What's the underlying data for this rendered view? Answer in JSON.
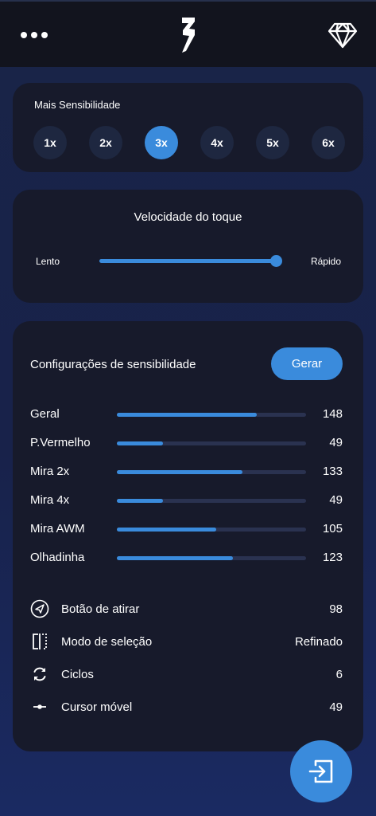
{
  "header": {
    "menu_icon": "more-dots-icon",
    "logo_icon": "brand-logo-icon",
    "premium_icon": "diamond-icon"
  },
  "sensitivity_multiplier": {
    "title": "Mais Sensibilidade",
    "options": [
      "1x",
      "2x",
      "3x",
      "4x",
      "5x",
      "6x"
    ],
    "selected": "3x"
  },
  "touch_speed": {
    "title": "Velocidade do toque",
    "min_label": "Lento",
    "max_label": "Rápido",
    "level": 1.0
  },
  "config": {
    "title": "Configurações de sensibilidade",
    "generate_label": "Gerar",
    "max_value": 200,
    "rows": [
      {
        "label": "Geral",
        "value": "148"
      },
      {
        "label": "P.Vermelho",
        "value": "49"
      },
      {
        "label": "Mira 2x",
        "value": "133"
      },
      {
        "label": "Mira 4x",
        "value": "49"
      },
      {
        "label": "Mira AWM",
        "value": "105"
      },
      {
        "label": "Olhadinha",
        "value": "123"
      }
    ],
    "options": [
      {
        "icon": "paper-plane-icon",
        "label": "Botão de atirar",
        "value": "98"
      },
      {
        "icon": "selection-mode-icon",
        "label": "Modo de seleção",
        "value": "Refinado"
      },
      {
        "icon": "refresh-cycle-icon",
        "label": "Ciclos",
        "value": "6"
      },
      {
        "icon": "cursor-slider-icon",
        "label": "Cursor móvel",
        "value": "49"
      }
    ]
  },
  "fab": {
    "icon": "exit-icon"
  },
  "colors": {
    "accent": "#3a8bdc",
    "card": "#171a2b",
    "track": "#2a3250",
    "topbar": "#12141e"
  }
}
